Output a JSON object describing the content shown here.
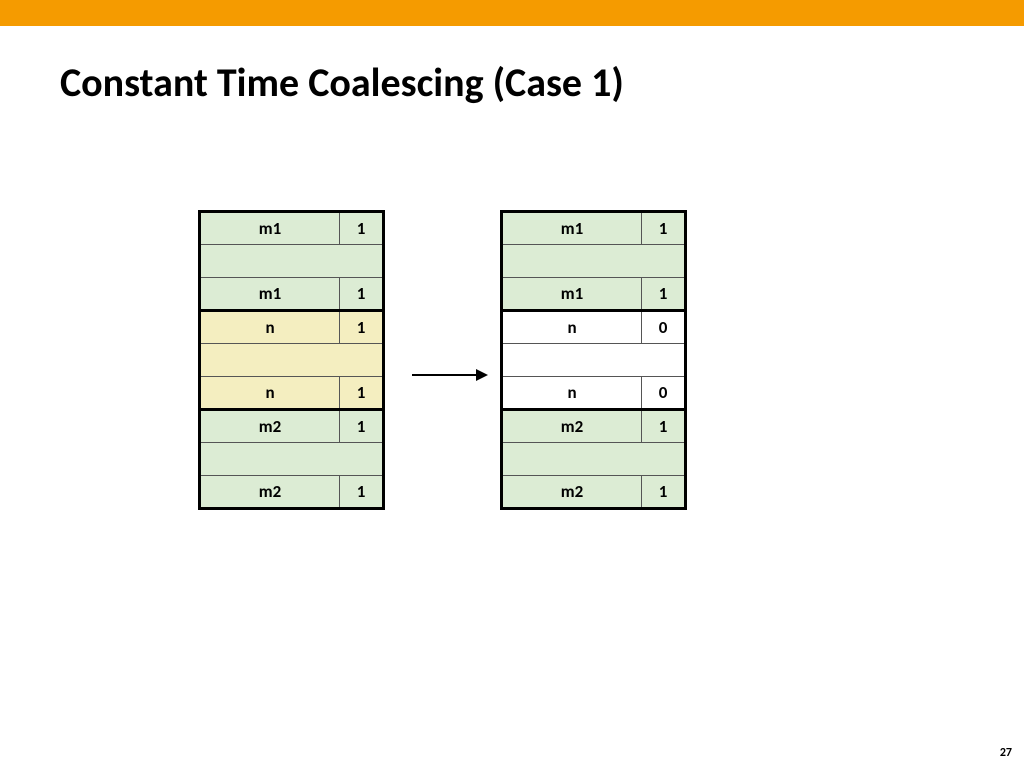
{
  "colors": {
    "accent_bar": "#f59b00",
    "green": "#dcecd4",
    "yellow": "#f4eec0",
    "white": "#ffffff"
  },
  "title": "Constant Time Coalescing (Case 1)",
  "page_number": "27",
  "left_table": {
    "r0": {
      "label": "m1",
      "flag": "1"
    },
    "r1": {
      "label": "",
      "flag": ""
    },
    "r2": {
      "label": "m1",
      "flag": "1"
    },
    "r3": {
      "label": "n",
      "flag": "1"
    },
    "r4": {
      "label": "",
      "flag": ""
    },
    "r5": {
      "label": "n",
      "flag": "1"
    },
    "r6": {
      "label": "m2",
      "flag": "1"
    },
    "r7": {
      "label": "",
      "flag": ""
    },
    "r8": {
      "label": "m2",
      "flag": "1"
    }
  },
  "right_table": {
    "r0": {
      "label": "m1",
      "flag": "1"
    },
    "r1": {
      "label": "",
      "flag": ""
    },
    "r2": {
      "label": "m1",
      "flag": "1"
    },
    "r3": {
      "label": "n",
      "flag": "0"
    },
    "r4": {
      "label": "",
      "flag": ""
    },
    "r5": {
      "label": "n",
      "flag": "0"
    },
    "r6": {
      "label": "m2",
      "flag": "1"
    },
    "r7": {
      "label": "",
      "flag": ""
    },
    "r8": {
      "label": "m2",
      "flag": "1"
    }
  }
}
